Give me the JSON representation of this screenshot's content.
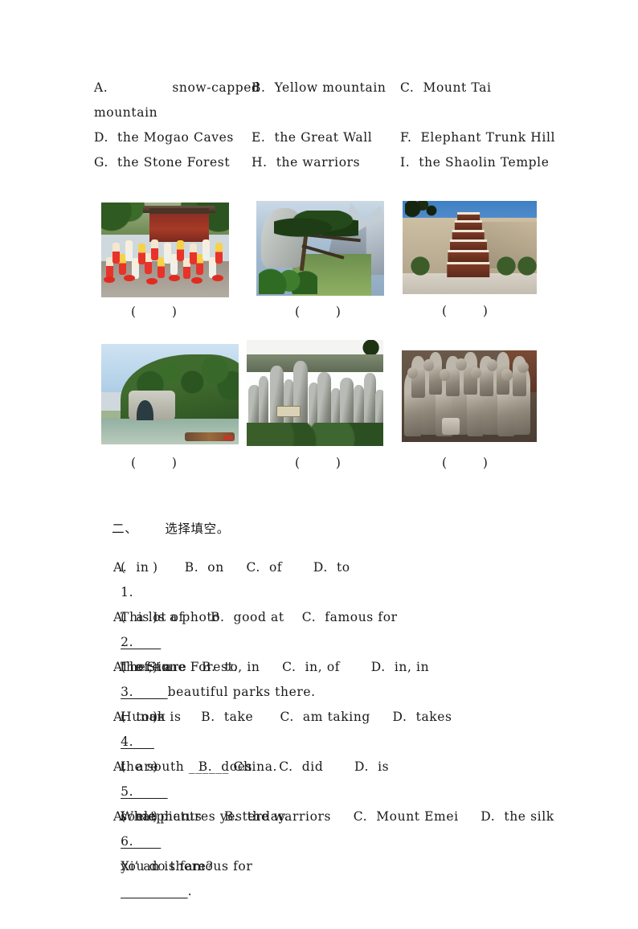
{
  "document": {
    "word_bank": {
      "rows": [
        {
          "a": "A.",
          "a_text": "snow-capped",
          "b": "B.  Yellow mountain",
          "c": "C.  Mount Tai"
        },
        {
          "a": "",
          "a_text": "mountain",
          "b": "",
          "c": ""
        },
        {
          "a": "D.  the Mogao Caves",
          "a_text": "",
          "b": "E.  the Great Wall",
          "c": "F.  Elephant Trunk Hill"
        },
        {
          "a": "G.  the Stone Forest",
          "a_text": "",
          "b": "H.  the warriors",
          "c": "I.  the Shaolin Temple"
        }
      ],
      "line1_label": "A.",
      "line1_item": "snow-capped",
      "line1_b": "B.  Yellow mountain",
      "line1_c": "C.  Mount Tai",
      "line2_cont": "mountain",
      "line3_a": "D.  the Mogao Caves",
      "line3_b": "E.  the Great Wall",
      "line3_c": "F.  Elephant Trunk Hill",
      "line4_a": "G.  the Stone Forest",
      "line4_b": "H.  the warriors",
      "line4_c": "I.  the Shaolin Temple"
    },
    "picture_grid": {
      "answer_mark": "(        )",
      "pictures": [
        {
          "id": 1,
          "caption": "shaolin-temple-kungfu-photo",
          "blank": "(        )"
        },
        {
          "id": 2,
          "caption": "yellow-mountain-pine-photo",
          "blank": "(        )"
        },
        {
          "id": 3,
          "caption": "mogao-caves-pagoda-photo",
          "blank": "(        )"
        },
        {
          "id": 4,
          "caption": "elephant-trunk-hill-photo",
          "blank": "(        )"
        },
        {
          "id": 5,
          "caption": "stone-forest-photo",
          "blank": "(        )"
        },
        {
          "id": 6,
          "caption": "terracotta-warriors-photo",
          "blank": "(        )"
        }
      ]
    },
    "section_two": {
      "heading_number": "二、",
      "heading_title": "选择填空。",
      "questions": [
        {
          "bracket": "(      )",
          "number": "1.",
          "stem_before": "This is a photo",
          "blank": "______",
          "stem_after": "the Stone Forest.",
          "options": "A.  in        B.  on     C.  of       D.  to"
        },
        {
          "bracket": "(      )",
          "number": "2.",
          "stem_before": "There are",
          "blank": "_______",
          "stem_after": "beautiful parks there.",
          "options": "A.  a lot of      B.  good at    C.  famous for"
        },
        {
          "bracket": "(      )",
          "number": "3.",
          "stem_before": "Hunan is",
          "blank": "_____",
          "stem_after": "the south ______ China.",
          "options": "A.  of, in       B.  to, in     C.  in, of       D.  in, in"
        },
        {
          "bracket": "(      )",
          "number": "4.",
          "stem_before": "I",
          "blank": "_______",
          "stem_after": "some pictures yesterday.",
          "options": "A.  took        B.  take      C.  am taking     D.  takes"
        },
        {
          "bracket": "(      )",
          "number": "5.",
          "stem_before": "What",
          "blank": "______",
          "stem_after": "you do there?",
          "options": "A.  are         B.  does      C.  did       D.  is"
        },
        {
          "bracket": "(      )",
          "number": "6.",
          "stem_before": "Xi’ an is famous for",
          "blank": "__________",
          "stem_after": ".",
          "options": "A.  elephants     B.  the warriors     C.  Mount Emei     D.  the silk"
        }
      ]
    },
    "colors": {
      "page_background": "#ffffff",
      "text": "#1a1a1a"
    }
  }
}
